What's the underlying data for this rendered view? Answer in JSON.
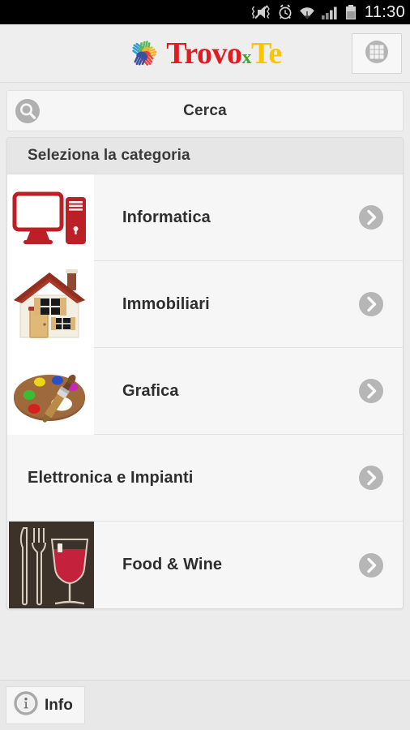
{
  "status_bar": {
    "time": "11:30",
    "icons": [
      "mute-vibrate-icon",
      "alarm-clock-icon",
      "wifi-icon",
      "cellular-signal-icon",
      "battery-icon"
    ]
  },
  "title_bar": {
    "logo": {
      "part_1": "Trovo",
      "part_2": "x",
      "part_3": "Te",
      "mark": "colored-hands-icon",
      "color_1": "#e01b22",
      "color_2": "#43a531",
      "color_3": "#f7c600"
    },
    "grid_button": {
      "icon": "apps-grid-icon"
    }
  },
  "search": {
    "label": "Cerca",
    "icon": "search-icon"
  },
  "categories": {
    "header": "Seleziona la categoria",
    "items": [
      {
        "label": "Informatica",
        "thumb": "computer-icon",
        "thumb_style": "white",
        "has_thumb": true
      },
      {
        "label": "Immobiliari",
        "thumb": "house-icon",
        "thumb_style": "white",
        "has_thumb": true
      },
      {
        "label": "Grafica",
        "thumb": "paint-palette-icon",
        "thumb_style": "white",
        "has_thumb": true
      },
      {
        "label": "Elettronica e Impianti",
        "thumb": "",
        "thumb_style": "plain",
        "has_thumb": false
      },
      {
        "label": "Food & Wine",
        "thumb": "food-wine-icon",
        "thumb_style": "plain",
        "has_thumb": true
      }
    ],
    "chevron_icon": "chevron-right-icon"
  },
  "bottom_bar": {
    "info_label": "Info",
    "info_icon": "info-circle-icon"
  },
  "colors": {
    "page_background": "#ececec",
    "panel_background": "#f6f6f6",
    "header_background": "#e6e6e6",
    "accent_red": "#c0272d",
    "food_wine_background": "#3d322a"
  }
}
